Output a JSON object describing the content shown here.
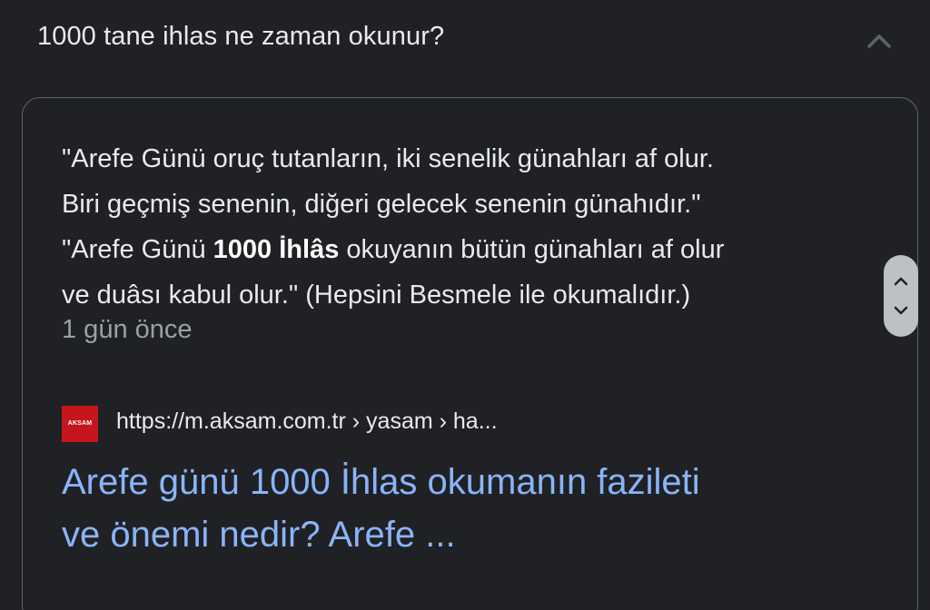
{
  "question": {
    "text": "1000 tane ihlas ne zaman okunur?",
    "toggle_icon": "chevron-up-icon"
  },
  "answer": {
    "line1": "\"Arefe Günü oruç tutanların, iki senelik günahları af olur.",
    "line2": "Biri geçmiş senenin, diğeri gelecek senenin günahıdır.\"",
    "line3_before": "\"Arefe Günü ",
    "line3_bold": "1000 İhlâs",
    "line3_after": " okuyanın bütün günahları af olur",
    "line4": "ve duâsı kabul olur.\" (Hepsini Besmele ile okumalıdır.)",
    "date": "1 gün önce"
  },
  "source": {
    "favicon_text": "AKSAM",
    "url": "https://m.aksam.com.tr › yasam › ha..."
  },
  "result": {
    "title_line1": "Arefe günü 1000 İhlas okumanın fazileti",
    "title_line2": "ve önemi nedir? Arefe ..."
  },
  "colors": {
    "background": "#202124",
    "text": "#e8eaed",
    "muted": "#9aa0a6",
    "link": "#8ab4f8",
    "favicon": "#c4161c",
    "scroll_widget": "#bdc1c6"
  },
  "scroll_controls": {
    "up_icon": "chevron-up-icon",
    "down_icon": "chevron-down-icon"
  }
}
